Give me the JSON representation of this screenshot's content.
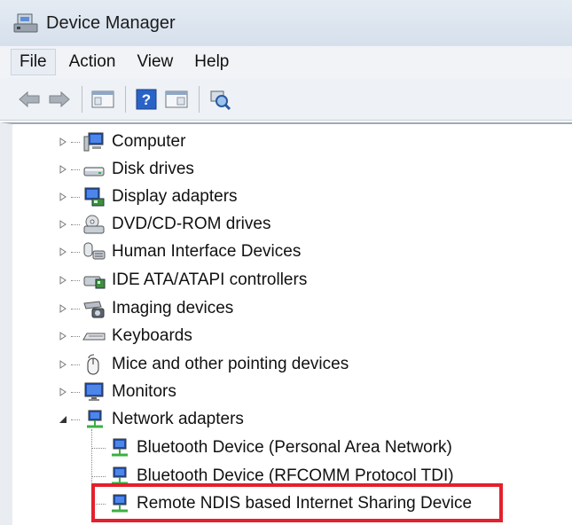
{
  "window": {
    "title": "Device Manager"
  },
  "menu": [
    {
      "label": "File",
      "active": true
    },
    {
      "label": "Action",
      "active": false
    },
    {
      "label": "View",
      "active": false
    },
    {
      "label": "Help",
      "active": false
    }
  ],
  "toolbar": {
    "buttons": [
      "back-arrow-icon",
      "forward-arrow-icon",
      "show-hide-tree-icon",
      "help-icon",
      "properties-pane-icon",
      "scan-hardware-icon"
    ]
  },
  "tree": {
    "categories": [
      {
        "label": "Computer",
        "icon": "computer-icon",
        "expanded": false
      },
      {
        "label": "Disk drives",
        "icon": "disk-drive-icon",
        "expanded": false
      },
      {
        "label": "Display adapters",
        "icon": "display-adapter-icon",
        "expanded": false
      },
      {
        "label": "DVD/CD-ROM drives",
        "icon": "dvd-drive-icon",
        "expanded": false
      },
      {
        "label": "Human Interface Devices",
        "icon": "hid-icon",
        "expanded": false
      },
      {
        "label": "IDE ATA/ATAPI controllers",
        "icon": "ide-controller-icon",
        "expanded": false
      },
      {
        "label": "Imaging devices",
        "icon": "imaging-device-icon",
        "expanded": false
      },
      {
        "label": "Keyboards",
        "icon": "keyboard-icon",
        "expanded": false
      },
      {
        "label": "Mice and other pointing devices",
        "icon": "mouse-icon",
        "expanded": false
      },
      {
        "label": "Monitors",
        "icon": "monitor-icon",
        "expanded": false
      },
      {
        "label": "Network adapters",
        "icon": "network-adapter-icon",
        "expanded": true
      }
    ],
    "network_children": [
      {
        "label": "Bluetooth Device (Personal Area Network)",
        "icon": "network-adapter-icon"
      },
      {
        "label": "Bluetooth Device (RFCOMM Protocol TDI)",
        "icon": "network-adapter-icon"
      },
      {
        "label": "Remote NDIS based Internet Sharing Device",
        "icon": "network-adapter-icon",
        "highlighted": true
      }
    ]
  },
  "colors": {
    "highlight": "#e3202c",
    "titlebar": "#dce5ef",
    "accent": "#2a63c7"
  }
}
